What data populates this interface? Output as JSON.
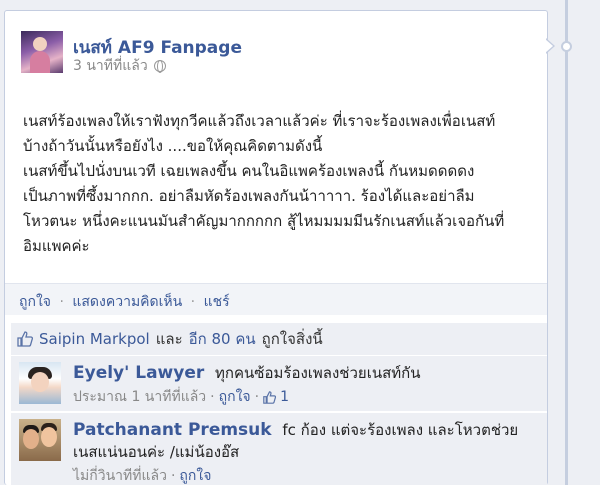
{
  "post": {
    "page_name": "เนสท์ AF9 Fanpage",
    "timestamp": "3 นาทีที่แล้ว",
    "privacy_icon": "globe-icon",
    "body_lines": [
      "เนสท์ร้องเพลงให้เราฟังทุกวีคแล้วถึงเวลาแล้วค่ะ ที่เราจะร้องเพลงเพื่อเนสท์",
      "บ้างถ้าวันนั้นหรือยังไง ....ขอให้คุณคิดตามดังนี้",
      "เนสท์ขึ้นไปนั่งบนเวที เฉยเพลงขึ้น คนในอิแพคร้องเพลงนี้ กันหมดดดดง",
      "เป็นภาพที่ซึ้งมากกก. อย่าลืมหัดร้องเพลงกันน้าาาาา. ร้องได้และอย่าลืม",
      "โหวตนะ หนึ่งคะแนนมันสำคัญมากกกกก สู้ไหมมมมมีนรักเนสท์แล้วเจอกันที่",
      "อิมแพคค่ะ"
    ]
  },
  "actions": {
    "like": "ถูกใจ",
    "comment": "แสดงความคิดเห็น",
    "share": "แชร์",
    "separator": "·"
  },
  "likes": {
    "icon": "thumbs-up-icon",
    "name": "Saipin Markpol",
    "and": "และ",
    "others": "อีก 80 คน",
    "suffix": "ถูกใจสิ่งนี้"
  },
  "comments": [
    {
      "author": "Eyely' Lawyer",
      "text_lines": [
        "ทุกคนซ้อมร้องเพลงช่วยเนสท์กัน"
      ],
      "time": "ประมาณ 1 นาทีที่แล้ว",
      "like": "ถูกใจ",
      "like_count": "1"
    },
    {
      "author": "Patchanant Premsuk",
      "text_lines": [
        "fc ก้อง แต่จะร้องเพลง และโหวตช่วย",
        "เนสแน่นอนค่ะ /แม่น้องอ๊ส"
      ],
      "time": "ไม่กี่วินาทีที่แล้ว",
      "like": "ถูกใจ"
    }
  ],
  "colors": {
    "link": "#3b5998",
    "panel": "#edeff4",
    "border": "#c4cde0"
  }
}
